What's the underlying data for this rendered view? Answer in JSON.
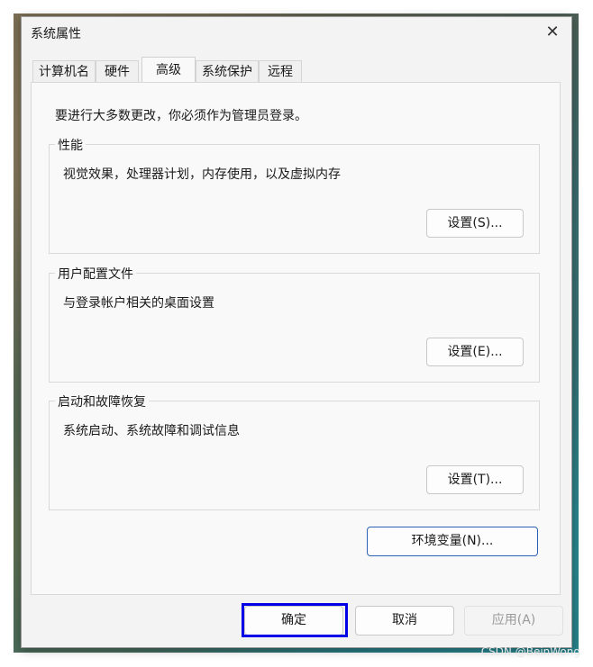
{
  "window": {
    "title": "系统属性"
  },
  "tabs": [
    "计算机名",
    "硬件",
    "高级",
    "系统保护",
    "远程"
  ],
  "active_tab": "高级",
  "intro": "要进行大多数更改，你必须作为管理员登录。",
  "groups": [
    {
      "title": "性能",
      "description": "视觉效果，处理器计划，内存使用，以及虚拟内存",
      "button": "设置(S)..."
    },
    {
      "title": "用户配置文件",
      "description": "与登录帐户相关的桌面设置",
      "button": "设置(E)..."
    },
    {
      "title": "启动和故障恢复",
      "description": "系统启动、系统故障和调试信息",
      "button": "设置(T)..."
    }
  ],
  "env_button": "环境变量(N)...",
  "footer": {
    "ok": "确定",
    "cancel": "取消",
    "apply": "应用(A)"
  },
  "watermark": "CSDN @BeinWong",
  "colors": {
    "highlight_border": "#0000e6",
    "env_button_border": "#2c62b5"
  },
  "icons": {
    "close": "close-icon"
  }
}
